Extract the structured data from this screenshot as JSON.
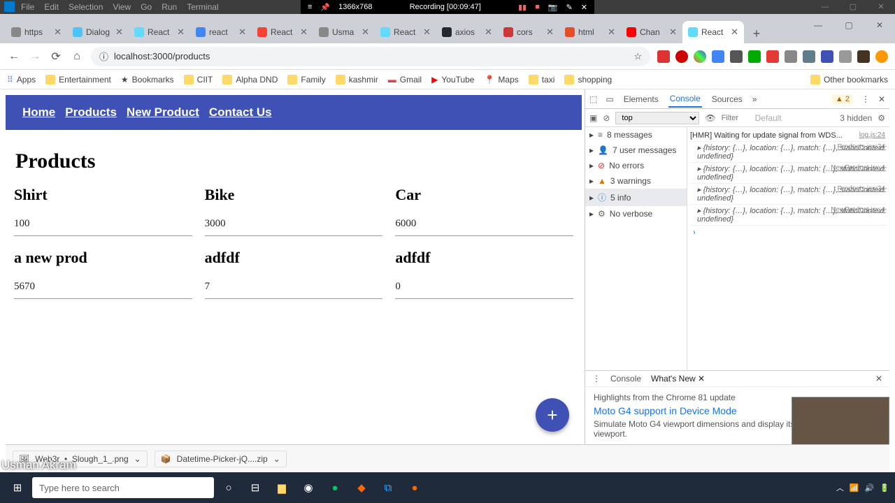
{
  "recorder": {
    "res": "1366x768",
    "status": "Recording [00:09:47]"
  },
  "vsmenu": [
    "File",
    "Edit",
    "Selection",
    "View",
    "Go",
    "Run",
    "Terminal"
  ],
  "tabs": [
    {
      "label": "https",
      "fav": "#888"
    },
    {
      "label": "Dialog",
      "fav": "#4fc3f7"
    },
    {
      "label": "React",
      "fav": "#61dafb"
    },
    {
      "label": "react",
      "fav": "#4285f4"
    },
    {
      "label": "React",
      "fav": "#f44336"
    },
    {
      "label": "Usma",
      "fav": "#888"
    },
    {
      "label": "React",
      "fav": "#61dafb"
    },
    {
      "label": "axios",
      "fav": "#24292e"
    },
    {
      "label": "cors",
      "fav": "#cb3837"
    },
    {
      "label": "html",
      "fav": "#e44d26"
    },
    {
      "label": "Chan",
      "fav": "#ff0000"
    },
    {
      "label": "React",
      "fav": "#61dafb",
      "active": true
    }
  ],
  "url": "localhost:3000/products",
  "bookmarks": [
    {
      "label": "Apps",
      "icon": "grid"
    },
    {
      "label": "Entertainment",
      "icon": "folder"
    },
    {
      "label": "Bookmarks",
      "icon": "star"
    },
    {
      "label": "CIIT",
      "icon": "folder"
    },
    {
      "label": "Alpha DND",
      "icon": "folder"
    },
    {
      "label": "Family",
      "icon": "folder"
    },
    {
      "label": "kashmir",
      "icon": "folder"
    },
    {
      "label": "Gmail",
      "icon": "gmail"
    },
    {
      "label": "YouTube",
      "icon": "yt"
    },
    {
      "label": "Maps",
      "icon": "maps"
    },
    {
      "label": "taxi",
      "icon": "folder"
    },
    {
      "label": "shopping",
      "icon": "folder"
    }
  ],
  "bm_other": "Other bookmarks",
  "nav": [
    "Home",
    "Products",
    "New Product",
    "Contact Us"
  ],
  "page_heading": "Products",
  "products": [
    {
      "name": "Shirt",
      "price": "100"
    },
    {
      "name": "Bike",
      "price": "3000"
    },
    {
      "name": "Car",
      "price": "6000"
    },
    {
      "name": "a new prod",
      "price": "5670"
    },
    {
      "name": "adfdf",
      "price": "7"
    },
    {
      "name": "adfdf",
      "price": "0"
    }
  ],
  "devtools": {
    "tabs": [
      "Elements",
      "Console",
      "Sources"
    ],
    "active": "Console",
    "warn": "▲ 2",
    "context": "top",
    "filter_ph": "Filter",
    "level": "Default",
    "hidden": "3 hidden",
    "side": [
      {
        "icon": "≡",
        "label": "8 messages"
      },
      {
        "icon": "👤",
        "label": "7 user messages"
      },
      {
        "icon": "⊘",
        "label": "No errors",
        "color": "#d93025"
      },
      {
        "icon": "▲",
        "label": "3 warnings",
        "color": "#e37400"
      },
      {
        "icon": "ⓘ",
        "label": "5 info",
        "color": "#1a73e8",
        "sel": true
      },
      {
        "icon": "⚙",
        "label": "No verbose"
      }
    ],
    "logs": [
      {
        "src": "log.js:24",
        "text": "[HMR] Waiting for update signal from WDS..."
      },
      {
        "src": "Products.jsx:34",
        "obj": "{history: {…}, location: {…}, match: {…}, staticContext: undefined}"
      },
      {
        "src": "NewProduct.jsx:4",
        "obj": "{history: {…}, location: {…}, match: {…}, staticContext: undefined}"
      },
      {
        "src": "Products.jsx:34",
        "obj": "{history: {…}, location: {…}, match: {…}, staticContext: undefined}"
      },
      {
        "src": "NewProduct.jsx:4",
        "obj": "{history: {…}, location: {…}, match: {…}, staticContext: undefined}"
      }
    ],
    "drawer": {
      "tabs": [
        "Console",
        "What's New"
      ],
      "highlight": "Highlights from the Chrome 81 update",
      "news_title": "Moto G4 support in Device Mode",
      "news_body": "Simulate Moto G4 viewport dimensions and display its hardware around the viewport."
    }
  },
  "downloads": [
    {
      "name": "Web3r_•_Slough_1_.png"
    },
    {
      "name": "Datetime-Picker-jQ....zip"
    }
  ],
  "overlay_name": "Usman Akram",
  "search_ph": "Type here to search"
}
